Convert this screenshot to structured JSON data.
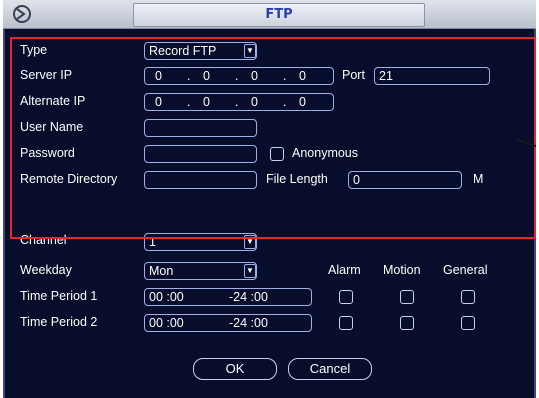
{
  "window": {
    "title": "FTP"
  },
  "form": {
    "type_label": "Type",
    "type_value": "Record FTP",
    "server_ip_label": "Server IP",
    "server_ip": [
      "0",
      "0",
      "0",
      "0"
    ],
    "port_label": "Port",
    "port_value": "21",
    "alternate_ip_label": "Alternate IP",
    "alternate_ip": [
      "0",
      "0",
      "0",
      "0"
    ],
    "user_name_label": "User Name",
    "user_name_value": "",
    "password_label": "Password",
    "password_value": "",
    "anonymous_label": "Anonymous",
    "remote_dir_label": "Remote Directory",
    "remote_dir_value": "",
    "file_length_label": "File Length",
    "file_length_value": "0",
    "file_length_unit": "M"
  },
  "schedule": {
    "channel_label": "Channel",
    "channel_value": "1",
    "weekday_label": "Weekday",
    "weekday_value": "Mon",
    "col_alarm": "Alarm",
    "col_motion": "Motion",
    "col_general": "General",
    "periods": [
      {
        "label": "Time Period 1",
        "start": "00 :00",
        "end": "-24 :00"
      },
      {
        "label": "Time Period 2",
        "start": "00 :00",
        "end": "-24 :00"
      }
    ]
  },
  "buttons": {
    "ok": "OK",
    "cancel": "Cancel"
  },
  "colors": {
    "background": "#070d2a",
    "highlight": "#e4262d",
    "title_text": "#2a3fa8"
  }
}
